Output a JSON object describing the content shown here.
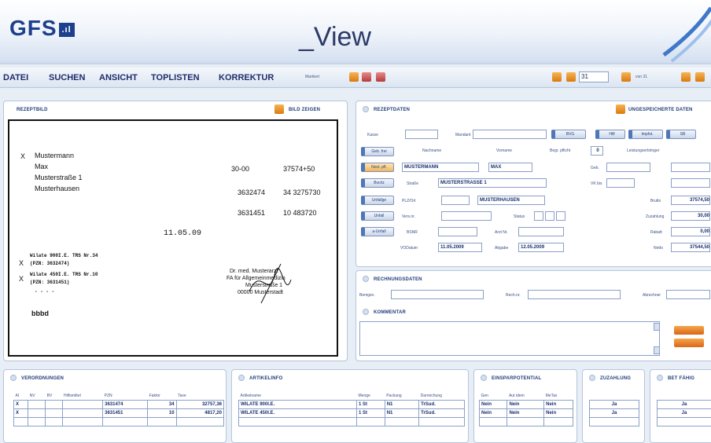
{
  "header": {
    "logo": "GFS",
    "logo_mark": ".ıl",
    "title": "_View"
  },
  "menu": {
    "items": [
      "DATEI",
      "SUCHEN",
      "ANSICHT",
      "TOPLISTEN",
      "KORREKTUR"
    ],
    "markiert_label": "Markiert",
    "page_value": "31",
    "page_suffix": "von 31"
  },
  "rezeptbild": {
    "title": "REZEPTBILD",
    "toggle_label": "BILD ZEIGEN",
    "patient": [
      "Mustermann",
      "Max",
      "Musterstraße 1",
      "Musterhausen"
    ],
    "numbers": {
      "n1": "30-00",
      "n2": "37574+50",
      "n3": "3632474",
      "n4": "34 3275730",
      "n5": "3631451",
      "n6": "10 483720"
    },
    "date": "11.05.09",
    "items": [
      "Wilate 900I.E. TRS Nr.34",
      "(PZN: 3632474)",
      "Wilate 450I.E. TRS Nr.10",
      "(PZN: 3631451)"
    ],
    "dashes": "-  -  -  -",
    "sig": "bbbd",
    "doctor": [
      "Dr. med. Musterarzt",
      "FA für Allgemeinmedizin",
      "Musterstraße 1",
      "00000 Musterstadt"
    ]
  },
  "rezeptdaten": {
    "title": "REZEPTDATEN",
    "unsaved_label": "UNGESPEICHERTE DATEN",
    "labels": {
      "kasse": "Kasse",
      "mandant": "Mandant",
      "nachname": "Nachname",
      "vorname": "Vorname",
      "begr": "Begr. pflicht",
      "leist": "Leistungserbringer",
      "strasse": "Straße",
      "plz": "PLZ/Ort",
      "vers": "Vers.nr.",
      "status": "Status",
      "bsnr": "BSNR",
      "arzt": "Arzt Nr.",
      "vodatum": "VODatum",
      "abgabe": "Abgabe",
      "geb": "Geb.",
      "vk": "VK bis",
      "brutto": "Brutto",
      "zuzahlung": "Zuzahlung",
      "rabatt": "Rabatt",
      "netto": "Netto"
    },
    "values": {
      "begr": "0",
      "nachname": "MUSTERMANN",
      "vorname": "MAX",
      "strasse": "MUSTERSTRASSE 1",
      "ort": "MUSTERHAUSEN",
      "vodatum": "11.05.2009",
      "abgabe": "12.05.2009",
      "brutto": "37574,50",
      "zuzahlung": "30,00",
      "rabatt": "0,00",
      "netto": "37544,50"
    },
    "side_buttons": [
      "Geb. frei",
      "Noct. pfl.",
      "Bvcrlz",
      "Unfallge",
      "Unfall",
      "a-Unfall"
    ],
    "top_buttons": [
      "BVG",
      "Hilf",
      "Impfst.",
      "SB"
    ]
  },
  "rechnungsdaten": {
    "title": "RECHNUNGSDATEN",
    "bemgsn": "Bemgsn.",
    "rechnr": "Rech.nr.",
    "abrechner": "Abrechner"
  },
  "kommentar": {
    "title": "KOMMENTAR"
  },
  "verordnungen": {
    "title": "VERORDNUNGEN",
    "headers": [
      "AI",
      "NV",
      "BV",
      "Hilfsmittel",
      "PZN",
      "Faktor",
      "Taxe"
    ],
    "rows": [
      [
        "X",
        "",
        "",
        "",
        "3631474",
        "34",
        "32757,36"
      ],
      [
        "X",
        "",
        "",
        "",
        "3631451",
        "10",
        "4817,20"
      ]
    ]
  },
  "artikelinfo": {
    "title": "ARTIKELINFO",
    "headers": [
      "Artikelname",
      "Menge",
      "Packung",
      "Darreichung"
    ],
    "rows": [
      [
        "WILATE 900I.E.",
        "1 St",
        "N1",
        "TrSud."
      ],
      [
        "WILATE 450I.E.",
        "1 St",
        "N1",
        "TrSud."
      ]
    ]
  },
  "einsparpotential": {
    "title": "EINSPARPOTENTIAL",
    "headers": [
      "Gen",
      "Aut idem",
      "MeTax"
    ],
    "rows": [
      [
        "Nein",
        "Nein",
        "Nein"
      ],
      [
        "Nein",
        "Nein",
        "Nein"
      ]
    ]
  },
  "zuzahlung": {
    "title": "ZUZAHLUNG",
    "rows": [
      "Ja",
      "Ja"
    ]
  },
  "btm": {
    "title": "BET FÄHIG",
    "rows": [
      "Ja",
      "Ja"
    ]
  }
}
